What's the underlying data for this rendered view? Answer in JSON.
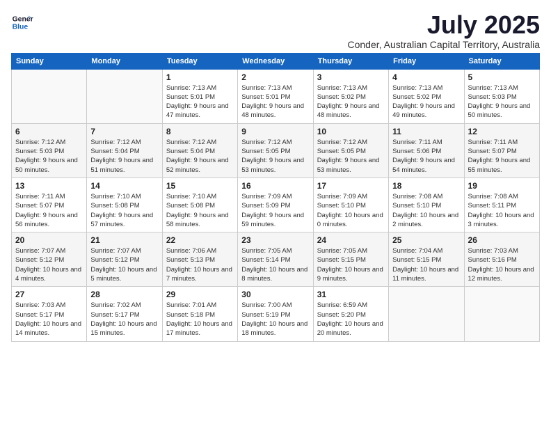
{
  "logo": {
    "line1": "General",
    "line2": "Blue"
  },
  "title": "July 2025",
  "subtitle": "Conder, Australian Capital Territory, Australia",
  "days_header": [
    "Sunday",
    "Monday",
    "Tuesday",
    "Wednesday",
    "Thursday",
    "Friday",
    "Saturday"
  ],
  "weeks": [
    [
      {
        "day": "",
        "info": ""
      },
      {
        "day": "",
        "info": ""
      },
      {
        "day": "1",
        "info": "Sunrise: 7:13 AM\nSunset: 5:01 PM\nDaylight: 9 hours and 47 minutes."
      },
      {
        "day": "2",
        "info": "Sunrise: 7:13 AM\nSunset: 5:01 PM\nDaylight: 9 hours and 48 minutes."
      },
      {
        "day": "3",
        "info": "Sunrise: 7:13 AM\nSunset: 5:02 PM\nDaylight: 9 hours and 48 minutes."
      },
      {
        "day": "4",
        "info": "Sunrise: 7:13 AM\nSunset: 5:02 PM\nDaylight: 9 hours and 49 minutes."
      },
      {
        "day": "5",
        "info": "Sunrise: 7:13 AM\nSunset: 5:03 PM\nDaylight: 9 hours and 50 minutes."
      }
    ],
    [
      {
        "day": "6",
        "info": "Sunrise: 7:12 AM\nSunset: 5:03 PM\nDaylight: 9 hours and 50 minutes."
      },
      {
        "day": "7",
        "info": "Sunrise: 7:12 AM\nSunset: 5:04 PM\nDaylight: 9 hours and 51 minutes."
      },
      {
        "day": "8",
        "info": "Sunrise: 7:12 AM\nSunset: 5:04 PM\nDaylight: 9 hours and 52 minutes."
      },
      {
        "day": "9",
        "info": "Sunrise: 7:12 AM\nSunset: 5:05 PM\nDaylight: 9 hours and 53 minutes."
      },
      {
        "day": "10",
        "info": "Sunrise: 7:12 AM\nSunset: 5:05 PM\nDaylight: 9 hours and 53 minutes."
      },
      {
        "day": "11",
        "info": "Sunrise: 7:11 AM\nSunset: 5:06 PM\nDaylight: 9 hours and 54 minutes."
      },
      {
        "day": "12",
        "info": "Sunrise: 7:11 AM\nSunset: 5:07 PM\nDaylight: 9 hours and 55 minutes."
      }
    ],
    [
      {
        "day": "13",
        "info": "Sunrise: 7:11 AM\nSunset: 5:07 PM\nDaylight: 9 hours and 56 minutes."
      },
      {
        "day": "14",
        "info": "Sunrise: 7:10 AM\nSunset: 5:08 PM\nDaylight: 9 hours and 57 minutes."
      },
      {
        "day": "15",
        "info": "Sunrise: 7:10 AM\nSunset: 5:08 PM\nDaylight: 9 hours and 58 minutes."
      },
      {
        "day": "16",
        "info": "Sunrise: 7:09 AM\nSunset: 5:09 PM\nDaylight: 9 hours and 59 minutes."
      },
      {
        "day": "17",
        "info": "Sunrise: 7:09 AM\nSunset: 5:10 PM\nDaylight: 10 hours and 0 minutes."
      },
      {
        "day": "18",
        "info": "Sunrise: 7:08 AM\nSunset: 5:10 PM\nDaylight: 10 hours and 2 minutes."
      },
      {
        "day": "19",
        "info": "Sunrise: 7:08 AM\nSunset: 5:11 PM\nDaylight: 10 hours and 3 minutes."
      }
    ],
    [
      {
        "day": "20",
        "info": "Sunrise: 7:07 AM\nSunset: 5:12 PM\nDaylight: 10 hours and 4 minutes."
      },
      {
        "day": "21",
        "info": "Sunrise: 7:07 AM\nSunset: 5:12 PM\nDaylight: 10 hours and 5 minutes."
      },
      {
        "day": "22",
        "info": "Sunrise: 7:06 AM\nSunset: 5:13 PM\nDaylight: 10 hours and 7 minutes."
      },
      {
        "day": "23",
        "info": "Sunrise: 7:05 AM\nSunset: 5:14 PM\nDaylight: 10 hours and 8 minutes."
      },
      {
        "day": "24",
        "info": "Sunrise: 7:05 AM\nSunset: 5:15 PM\nDaylight: 10 hours and 9 minutes."
      },
      {
        "day": "25",
        "info": "Sunrise: 7:04 AM\nSunset: 5:15 PM\nDaylight: 10 hours and 11 minutes."
      },
      {
        "day": "26",
        "info": "Sunrise: 7:03 AM\nSunset: 5:16 PM\nDaylight: 10 hours and 12 minutes."
      }
    ],
    [
      {
        "day": "27",
        "info": "Sunrise: 7:03 AM\nSunset: 5:17 PM\nDaylight: 10 hours and 14 minutes."
      },
      {
        "day": "28",
        "info": "Sunrise: 7:02 AM\nSunset: 5:17 PM\nDaylight: 10 hours and 15 minutes."
      },
      {
        "day": "29",
        "info": "Sunrise: 7:01 AM\nSunset: 5:18 PM\nDaylight: 10 hours and 17 minutes."
      },
      {
        "day": "30",
        "info": "Sunrise: 7:00 AM\nSunset: 5:19 PM\nDaylight: 10 hours and 18 minutes."
      },
      {
        "day": "31",
        "info": "Sunrise: 6:59 AM\nSunset: 5:20 PM\nDaylight: 10 hours and 20 minutes."
      },
      {
        "day": "",
        "info": ""
      },
      {
        "day": "",
        "info": ""
      }
    ]
  ]
}
